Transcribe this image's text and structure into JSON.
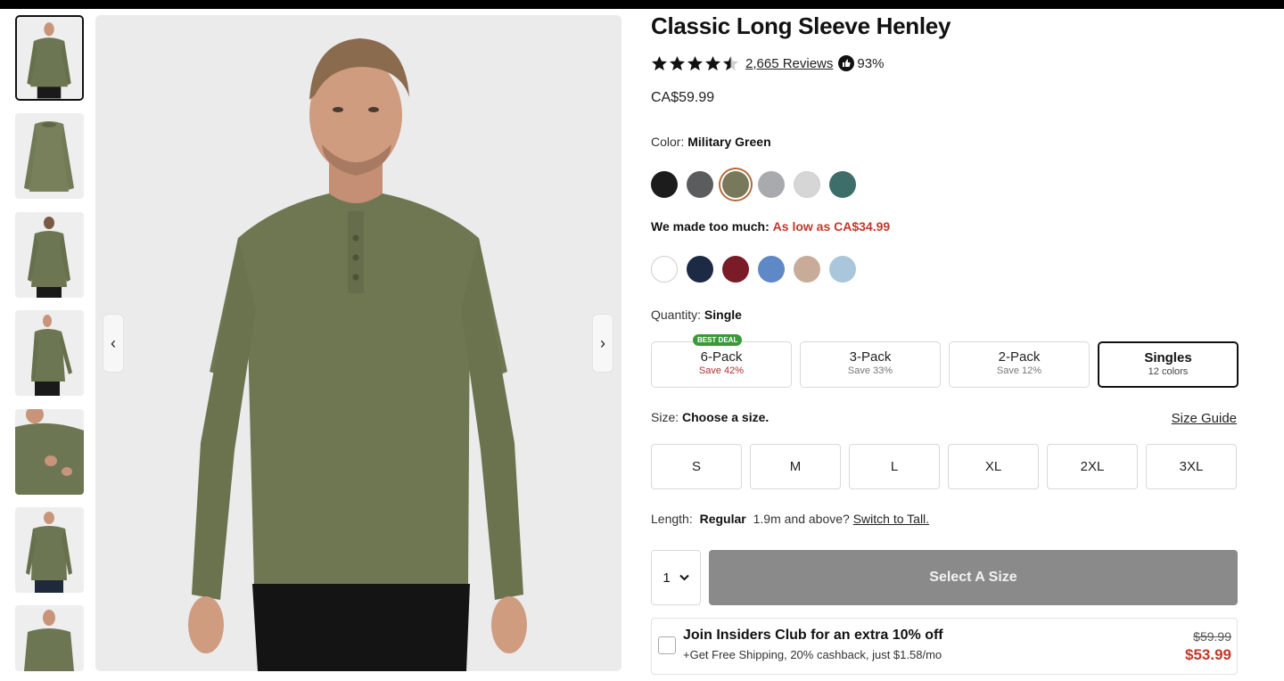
{
  "product": {
    "title": "Classic Long Sleeve Henley",
    "rating_value": 4.5,
    "reviews_label": "2,665 Reviews",
    "recommend_pct": "93%",
    "price": "CA$59.99"
  },
  "gallery": {
    "thumbnail_count": 7,
    "selected_index": 0,
    "prev_arrow": "‹",
    "next_arrow": "›"
  },
  "color": {
    "label": "Color:",
    "selected_name": "Military Green",
    "swatches": [
      "#1c1c1c",
      "#5b5c5e",
      "#77795a",
      "#a9aaae",
      "#d6d6d6",
      "#3d6e69"
    ]
  },
  "deal": {
    "label": "We made too much:",
    "value": "As low as CA$34.99",
    "swatches": [
      "#ffffff",
      "#1d2a44",
      "#7a1c27",
      "#5f88c6",
      "#c9ab99",
      "#a9c6dc"
    ]
  },
  "quantity": {
    "label": "Quantity:",
    "selected": "Single",
    "packs": [
      {
        "name": "6-Pack",
        "sub": "Save 42%",
        "badge": "BEST DEAL"
      },
      {
        "name": "3-Pack",
        "sub": "Save 33%"
      },
      {
        "name": "2-Pack",
        "sub": "Save 12%"
      },
      {
        "name": "Singles",
        "sub": "12 colors"
      }
    ]
  },
  "size": {
    "label": "Size:",
    "prompt": "Choose a size.",
    "guide": "Size Guide",
    "options": [
      "S",
      "M",
      "L",
      "XL",
      "2XL",
      "3XL"
    ]
  },
  "length": {
    "label": "Length:",
    "value": "Regular",
    "hint": "1.9m and above?",
    "link": "Switch to Tall."
  },
  "cart": {
    "qty": "1",
    "button": "Select A Size"
  },
  "insiders": {
    "title": "Join Insiders Club for an extra 10% off",
    "subtitle": "+Get Free Shipping, 20% cashback, just $1.58/mo",
    "old_price": "$59.99",
    "new_price": "$53.99"
  },
  "colors": {
    "accent_red": "#c0392b",
    "badge_green": "#3a9a3a",
    "selected_ring": "#b36b3d",
    "button_gray": "#8a8a8a"
  }
}
